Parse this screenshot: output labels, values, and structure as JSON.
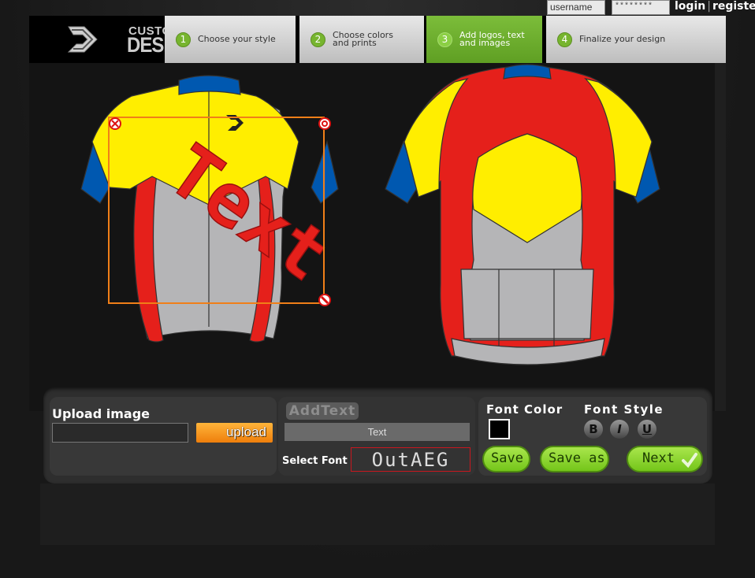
{
  "login": {
    "username_placeholder": "username",
    "password_mask": "********",
    "login_label": "login",
    "register_label": "register"
  },
  "logo": {
    "line1": "CUSTOM",
    "line2": "DESIGN"
  },
  "steps": [
    {
      "num": "1",
      "label": "Choose your style"
    },
    {
      "num": "2",
      "label": "Choose colors\nand prints"
    },
    {
      "num": "3",
      "label": "Add logos, text\nand images"
    },
    {
      "num": "4",
      "label": "Finalize your design"
    }
  ],
  "canvas": {
    "text_art": "Text",
    "colors": {
      "yellow": "#ffee00",
      "blue": "#0058b0",
      "red": "#e5201b",
      "gray": "#b5b5b7",
      "selection": "#f07f18"
    }
  },
  "upload": {
    "heading": "Upload image",
    "button": "upload"
  },
  "text_tool": {
    "title": "AddText",
    "input_value": "Text",
    "select_font_label": "Select Font",
    "font_preview": "OutAEG"
  },
  "font_tools": {
    "font_color_label": "Font Color",
    "font_style_label": "Font Style",
    "current_color": "#000000",
    "bold": "B",
    "italic": "I",
    "underline": "U",
    "save": "Save",
    "save_as": "Save as",
    "next": "Next"
  }
}
